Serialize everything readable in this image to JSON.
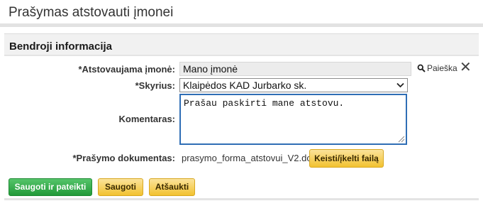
{
  "page": {
    "title": "Prašymas atstovauti įmonei"
  },
  "section": {
    "title": "Bendroji informacija"
  },
  "form": {
    "company": {
      "label": "*Atstovaujama įmonė:",
      "value": "Mano įmonė"
    },
    "search_link": "Paieška",
    "department": {
      "label": "*Skyrius:",
      "value": "Klaipėdos KAD Jurbarko sk."
    },
    "comment": {
      "label": "Komentaras:",
      "value": "Prašau paskirti mane atstovu."
    },
    "document": {
      "label": "*Prašymo dokumentas:",
      "file_name": "prasymo_forma_atstovui_V2.doc",
      "change_button": "Keisti/įkelti failą"
    }
  },
  "actions": {
    "save_submit": "Saugoti ir pateikti",
    "save": "Saugoti",
    "cancel": "Atšaukti"
  },
  "colors": {
    "primary_button": "#229a39",
    "secondary_button": "#f2c230",
    "focus_border": "#2f6eb5"
  },
  "icons": {
    "search": "search-icon",
    "clear": "close-icon",
    "dropdown": "chevron-down-icon",
    "resize": "resize-grip-icon"
  }
}
